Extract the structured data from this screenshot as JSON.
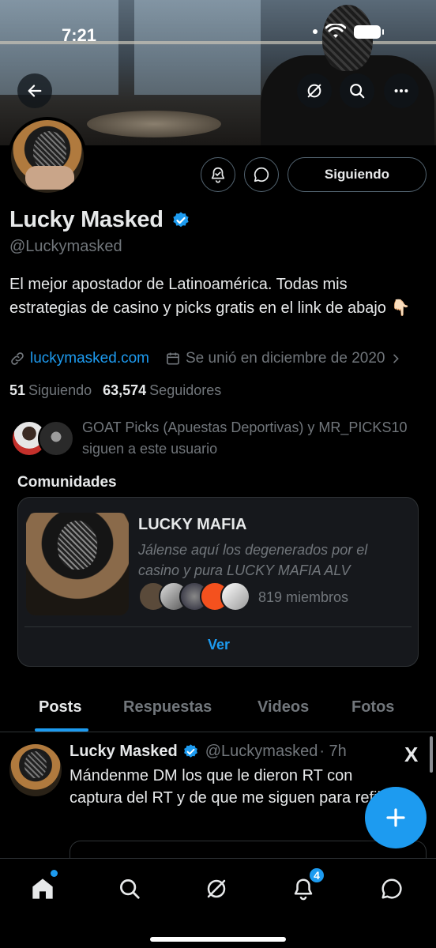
{
  "status_bar": {
    "time": "7:21"
  },
  "profile": {
    "name": "Lucky Masked",
    "handle": "@Luckymasked",
    "bio": "El mejor apostador de Latinoamérica. Todas mis estrategias de casino y picks gratis en el link de abajo 👇🏻",
    "website": "luckymasked.com",
    "joined": "Se unió en diciembre de 2020",
    "following_count": "51",
    "following_label": "Siguiendo",
    "followers_count": "63,574",
    "followers_label": "Seguidores",
    "follow_button_label": "Siguiendo",
    "followed_by_text": "GOAT Picks (Apuestas Deportivas) y MR_PICKS10 siguen a este usuario"
  },
  "communities": {
    "section_title": "Comunidades",
    "name": "LUCKY MAFIA",
    "description": "Jálense aquí los degenerados por el casino y pura LUCKY MAFIA ALV",
    "members_label": "819 miembros",
    "view_label": "Ver"
  },
  "tabs": [
    {
      "label": "Posts"
    },
    {
      "label": "Respuestas"
    },
    {
      "label": "Videos"
    },
    {
      "label": "Fotos"
    }
  ],
  "post": {
    "author_name": "Lucky Masked",
    "author_handle": "@Luckymasked",
    "time": "· 7h",
    "text": "Mándenme DM los que le dieron RT con captura del RT y de que me siguen para refil",
    "source_logo": "X"
  },
  "bottom_nav": {
    "notifications_badge": "4"
  },
  "colors": {
    "accent": "#1d9bf0",
    "background": "#000000",
    "text_primary": "#e7e9ea",
    "text_secondary": "#71767b",
    "border": "#2f3336"
  },
  "icons": [
    "back-arrow-icon",
    "grok-icon",
    "search-icon",
    "more-icon",
    "notification-bell-icon",
    "message-icon",
    "verified-badge-icon",
    "link-icon",
    "calendar-icon",
    "chevron-right-icon",
    "x-logo-icon",
    "plus-icon",
    "home-icon",
    "notifications-icon"
  ]
}
